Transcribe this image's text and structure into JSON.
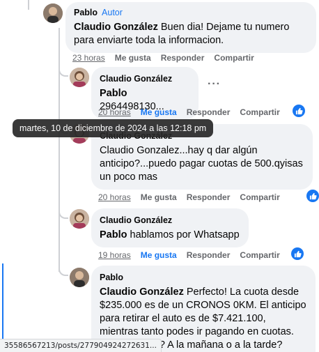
{
  "comments": [
    {
      "author": "Pablo",
      "badge": "Autor",
      "mention": "Claudio González",
      "text": " Buen dia! Dejame tu numero para enviarte toda la informacion.",
      "time": "23 horas",
      "like": "Me gusta",
      "reply": "Responder",
      "share": "Compartir"
    },
    {
      "author": "Claudio González",
      "mention": "Pablo",
      "text": " 2964498130...",
      "more": "···",
      "time": "20 horas",
      "like": "Me gusta",
      "reply": "Responder",
      "share": "Compartir"
    },
    {
      "author": "Claudio González",
      "text": "Claudio Gonzalez...hay q dar algún anticipo?...puedo pagar cuotas de 500.qyisas un poco mas",
      "time": "20 horas",
      "like": "Me gusta",
      "reply": "Responder",
      "share": "Compartir"
    },
    {
      "author": "Claudio González",
      "mention": "Pablo",
      "text": " hablamos por Whatsapp",
      "time": "19 horas",
      "like": "Me gusta",
      "reply": "Responder",
      "share": "Compartir"
    },
    {
      "author": "Pablo",
      "mention": "Claudio González",
      "text": " Perfecto! La cuota desde $235.000 es de un CRONOS 0KM. El anticipo para retirar el auto es de $7.421.100, mientras tanto podes ir pagando en cuotas. Cuándo",
      "text_tail": "r? A la mañana o a la tarde?"
    }
  ],
  "tooltip": "martes, 10 de diciembre de 2024 a las 12:18 pm",
  "status_url": "35586567213/posts/277904924272631...",
  "colors": {
    "accent": "#1877f2",
    "bubble": "#f0f2f5",
    "meta": "#65676b"
  }
}
